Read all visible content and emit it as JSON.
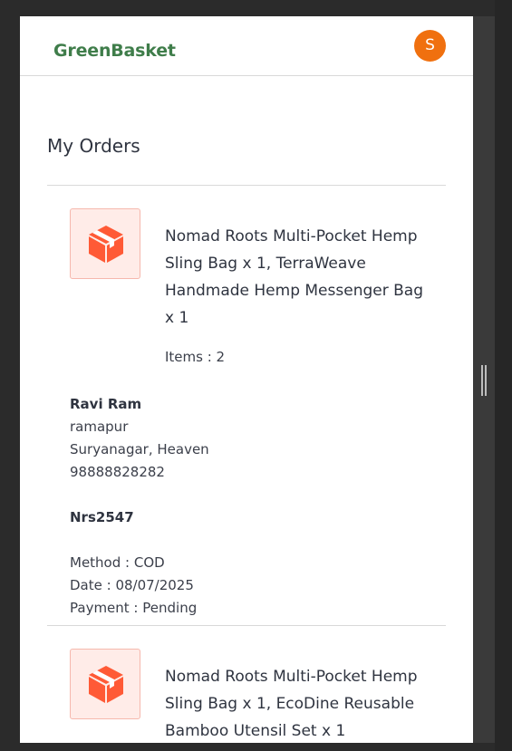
{
  "header": {
    "brand": "GreenBasket",
    "avatar_initial": "S",
    "avatar_color": "#f0700f"
  },
  "page": {
    "title": "My Orders"
  },
  "orders": [
    {
      "product_icon": "package-box-icon",
      "title": "Nomad Roots Multi-Pocket Hemp Sling Bag x 1, TerraWeave Handmade Hemp Messenger Bag x 1",
      "items_text": "Items : 2",
      "customer_name": "Ravi Ram",
      "address_line1": "ramapur",
      "address_line2": "Suryanagar, Heaven",
      "phone": "98888828282",
      "amount": "Nrs2547",
      "method": "Method : COD",
      "date": "Date : 08/07/2025",
      "payment": "Payment : Pending"
    },
    {
      "product_icon": "package-box-icon",
      "title": "Nomad Roots Multi-Pocket Hemp Sling Bag x 1, EcoDine Reusable Bamboo Utensil Set x 1"
    }
  ]
}
